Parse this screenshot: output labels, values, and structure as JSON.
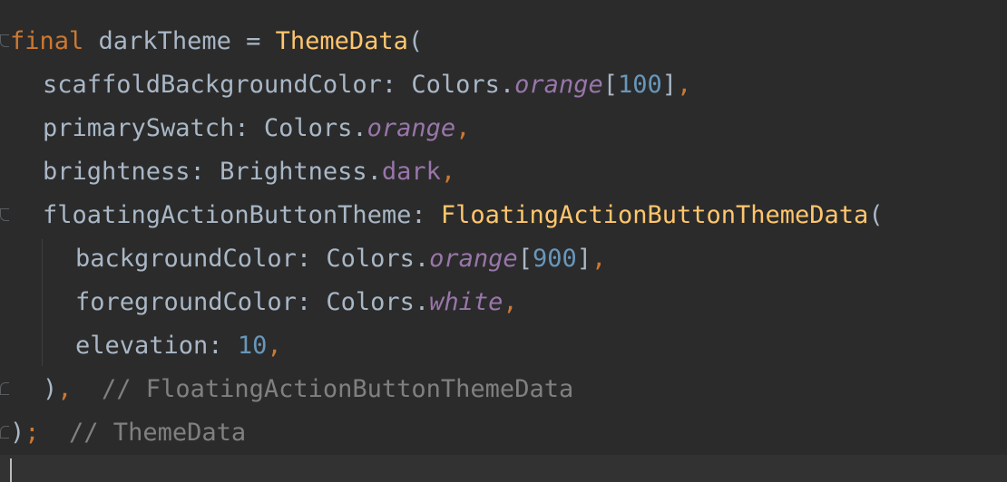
{
  "editor": {
    "lines": [
      {
        "tokens": [
          "final",
          " darkTheme = ",
          "ThemeData",
          "("
        ]
      },
      {
        "tokens": [
          "scaffoldBackgroundColor: Colors.",
          "orange",
          "[",
          "100",
          "]",
          ","
        ]
      },
      {
        "tokens": [
          "primarySwatch: Colors.",
          "orange",
          ","
        ]
      },
      {
        "tokens": [
          "brightness: Brightness.",
          "dark",
          ","
        ]
      },
      {
        "tokens": [
          "floatingActionButtonTheme: ",
          "FloatingActionButtonThemeData",
          "("
        ]
      },
      {
        "tokens": [
          "backgroundColor: Colors.",
          "orange",
          "[",
          "900",
          "]",
          ","
        ]
      },
      {
        "tokens": [
          "foregroundColor: Colors.",
          "white",
          ","
        ]
      },
      {
        "tokens": [
          "elevation: ",
          "10",
          ","
        ]
      },
      {
        "tokens": [
          ")",
          ",",
          "  // FloatingActionButtonThemeData"
        ]
      },
      {
        "tokens": [
          ")",
          ";",
          "  // ThemeData"
        ]
      }
    ]
  },
  "colors": {
    "background": "#2b2b2b",
    "keyword": "#cc7832",
    "function": "#ffc66d",
    "property": "#9876aa",
    "number": "#6897bb",
    "comment": "#808080",
    "text": "#a9b7c6"
  }
}
